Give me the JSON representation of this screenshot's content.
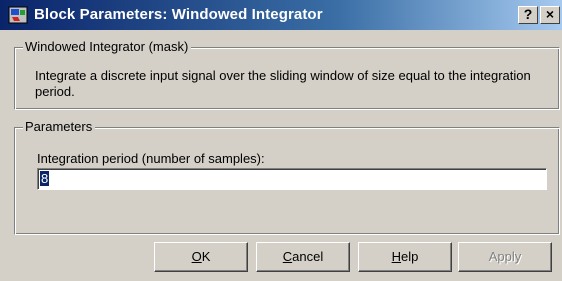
{
  "titlebar": {
    "title": "Block Parameters: Windowed Integrator",
    "help_label": "?",
    "close_label": "×"
  },
  "mask_group": {
    "legend": "Windowed Integrator (mask)",
    "description": "Integrate a discrete input signal over the sliding window of size equal to the integration period."
  },
  "params_group": {
    "legend": "Parameters",
    "field_label": "Integration period (number of samples):",
    "field_value": "8"
  },
  "buttons": {
    "ok_mnemonic": "O",
    "ok_rest": "K",
    "cancel_mnemonic": "C",
    "cancel_rest": "ancel",
    "help_mnemonic": "H",
    "help_rest": "elp",
    "apply_label": "Apply"
  },
  "icons": {
    "app": "simulink-block-icon",
    "help": "help-icon",
    "close": "close-icon"
  },
  "colors": {
    "titlebar_start": "#0a246a",
    "titlebar_end": "#a6caf0",
    "face": "#d4d0c8",
    "selection": "#0a246a"
  }
}
